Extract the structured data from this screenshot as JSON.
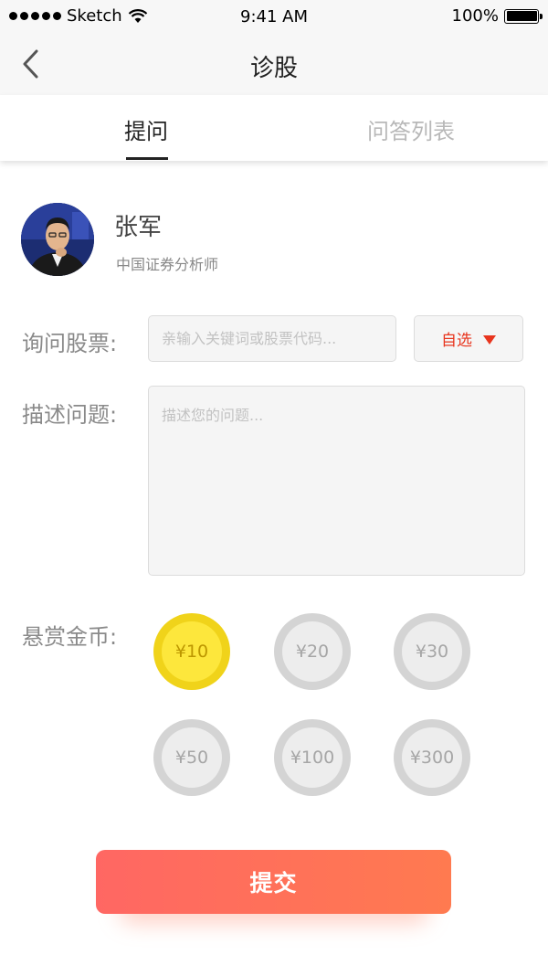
{
  "status_bar": {
    "carrier": "Sketch",
    "time": "9:41 AM",
    "battery": "100%"
  },
  "nav": {
    "title": "诊股",
    "back_icon": "chevron-left-icon"
  },
  "tabs": [
    {
      "label": "提问",
      "active": true
    },
    {
      "label": "问答列表",
      "active": false
    }
  ],
  "analyst": {
    "name": "张军",
    "title": "中国证券分析师"
  },
  "form": {
    "stock_label": "询问股票:",
    "stock_placeholder": "亲输入关键词或股票代码...",
    "select_label": "自选",
    "desc_label": "描述问题:",
    "desc_placeholder": "描述您的问题...",
    "reward_label": "悬赏金币:",
    "coins": [
      {
        "label": "¥10",
        "selected": true
      },
      {
        "label": "¥20",
        "selected": false
      },
      {
        "label": "¥30",
        "selected": false
      },
      {
        "label": "¥50",
        "selected": false
      },
      {
        "label": "¥100",
        "selected": false
      },
      {
        "label": "¥300",
        "selected": false
      }
    ],
    "submit_label": "提交"
  },
  "colors": {
    "accent_red": "#e8351e",
    "coin_selected": "#fde73c",
    "submit_start": "#ff6763",
    "submit_end": "#ff7a50"
  }
}
